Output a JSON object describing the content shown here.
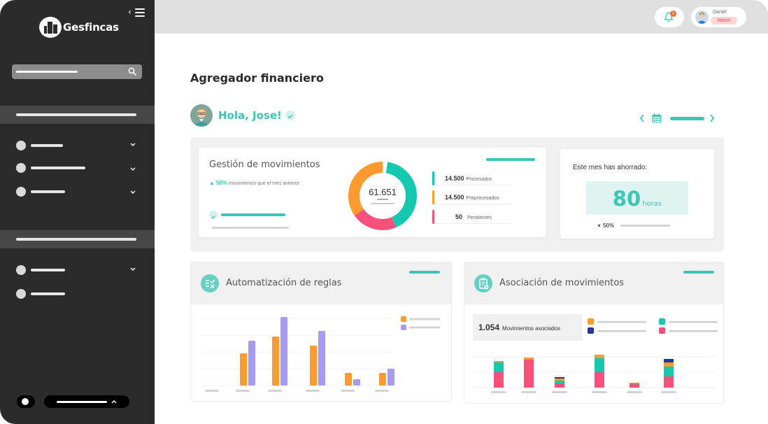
{
  "app": {
    "brand": "Gesfincas"
  },
  "topbar": {
    "notifications_count": "1",
    "user": {
      "name": "Daniel",
      "role": "Admin"
    }
  },
  "page": {
    "title": "Agregador financiero",
    "greeting": "Hola, Jose!"
  },
  "gestion": {
    "title": "Gestión de movimientos",
    "trend_arrow": "▲",
    "trend_pct": "50%",
    "trend_text": "movimientos que el mes anterior",
    "total": "61.651",
    "legend": [
      {
        "value": "14.500",
        "label": "Procesados",
        "color": "#14c9b0"
      },
      {
        "value": "14.500",
        "label": "Preprocesados",
        "color": "#ff9a2e"
      },
      {
        "value": "50",
        "label": "Pendientes",
        "color": "#f7507a"
      }
    ]
  },
  "ahorro": {
    "title": "Este mes has ahorrado:",
    "value": "80",
    "unit": "horas",
    "trend_arrow": "▼",
    "trend_pct": "50%"
  },
  "automatizacion": {
    "title": "Automatización de reglas",
    "icon": "rules-check-icon"
  },
  "asociacion": {
    "title": "Asociación de movimientos",
    "icon": "clipboard-icon",
    "stat_value": "1.054",
    "stat_label": "Movimientos asociados"
  },
  "colors": {
    "accent": "#3cc5b5",
    "orange": "#ff9a2e",
    "purple": "#a79bef",
    "pink": "#f7507a",
    "teal": "#14c9b0",
    "navy": "#23349a",
    "sidebar": "#2b2b2b"
  },
  "chart_data": [
    {
      "type": "bar",
      "categories": [
        "",
        "",
        "",
        "",
        "",
        ""
      ],
      "series": [
        {
          "values": [
            0,
            46,
            70,
            57,
            18,
            18
          ]
        },
        {
          "values": [
            0,
            64,
            98,
            78,
            9,
            24
          ]
        }
      ]
    },
    {
      "type": "bar",
      "stacked": true,
      "categories": [
        "",
        "",
        "",
        "",
        "",
        ""
      ],
      "series": [
        {
          "values": [
            22,
            40,
            6,
            22,
            5,
            16
          ]
        },
        {
          "values": [
            14,
            0,
            4,
            20,
            1,
            14
          ]
        },
        {
          "values": [
            2,
            3,
            3,
            5,
            1,
            6
          ]
        },
        {
          "values": [
            0,
            0,
            2,
            0,
            0,
            5
          ]
        }
      ]
    }
  ]
}
